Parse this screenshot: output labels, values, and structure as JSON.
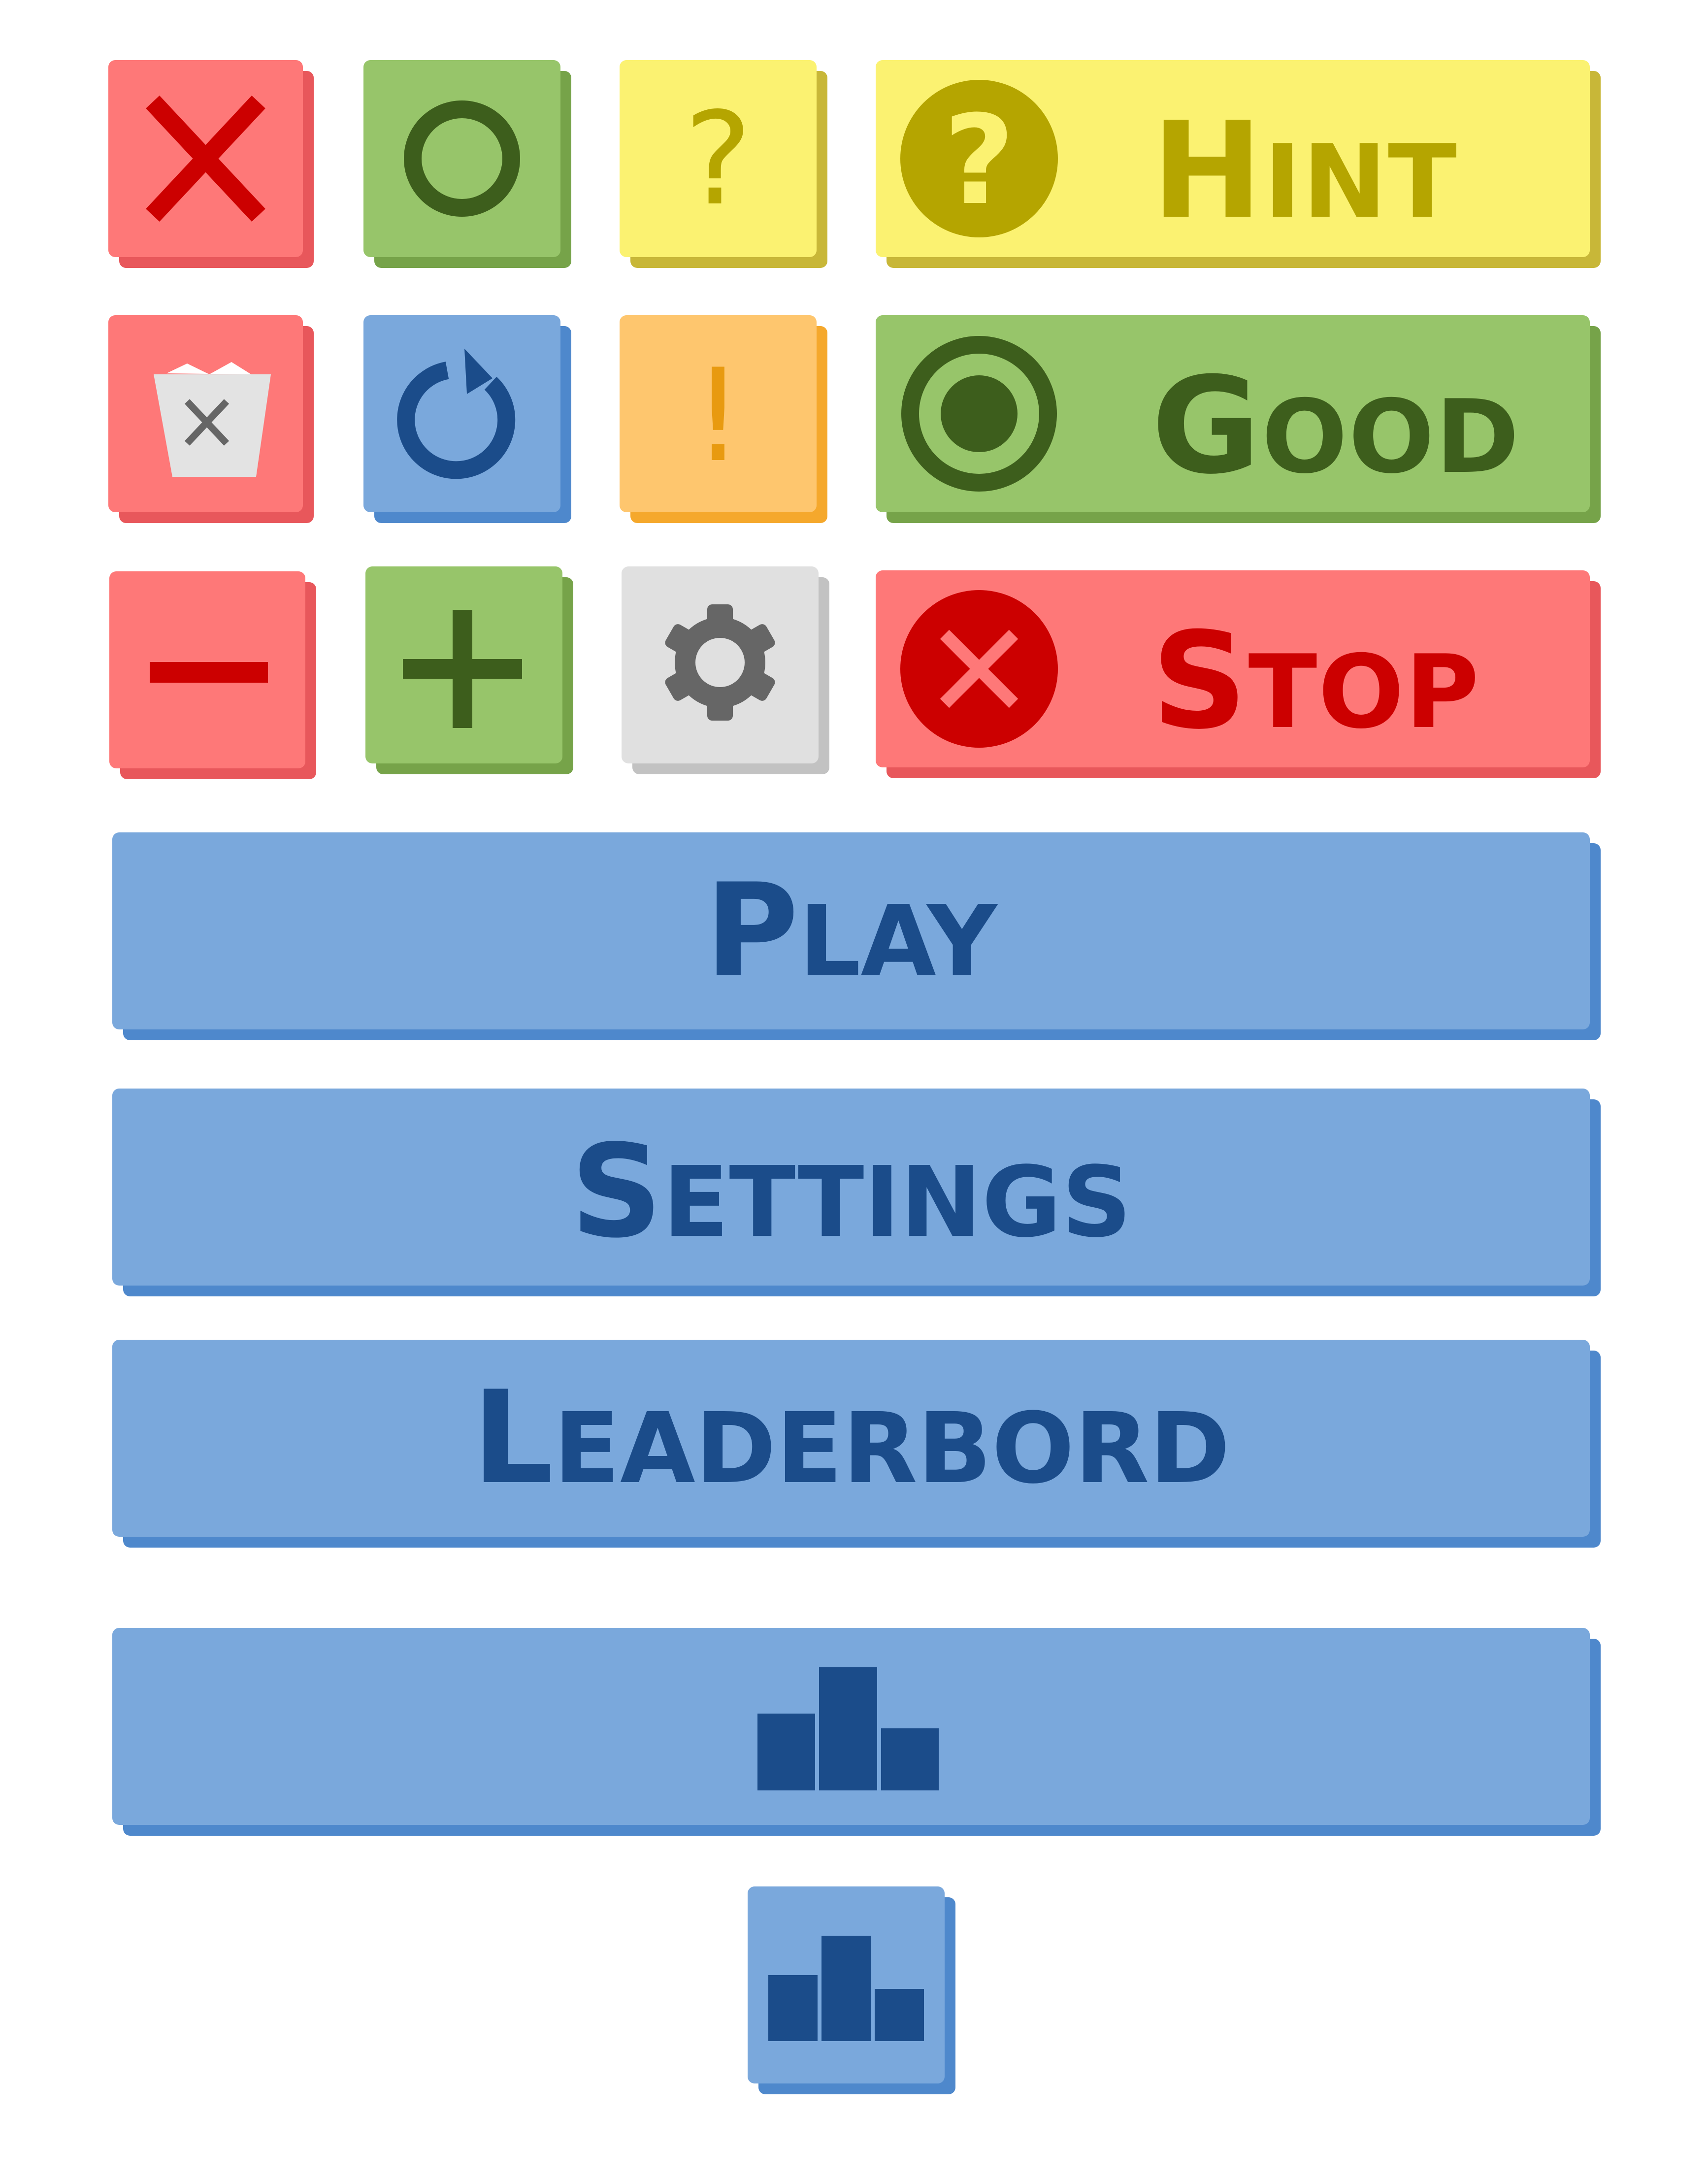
{
  "colors": {
    "red_face": "#fe7878",
    "red_shadow": "#e8575b",
    "red_icon": "#cc0000",
    "green_face": "#97c56a",
    "green_shadow": "#76a349",
    "green_icon": "#3d5e1c",
    "yellow_face": "#fbf271",
    "yellow_shadow": "#c8b738",
    "yellow_icon": "#b5a500",
    "blue_face": "#7aa8dc",
    "blue_shadow": "#4e88cc",
    "blue_icon": "#1b4c8a",
    "orange_face": "#fec66e",
    "orange_shadow": "#f5a82c",
    "orange_icon": "#e89a10",
    "gray_face": "#e0e0e0",
    "gray_shadow": "#c2c2c2",
    "gray_icon": "#666666"
  },
  "icon_buttons": [
    {
      "name": "close-button",
      "icon": "close-icon"
    },
    {
      "name": "confirm-button",
      "icon": "circle-icon"
    },
    {
      "name": "question-button",
      "icon": "question-icon"
    },
    {
      "name": "trash-button",
      "icon": "trash-icon"
    },
    {
      "name": "restart-button",
      "icon": "restart-icon"
    },
    {
      "name": "alert-button",
      "icon": "exclamation-icon"
    },
    {
      "name": "minus-button",
      "icon": "minus-icon"
    },
    {
      "name": "plus-button",
      "icon": "plus-icon"
    },
    {
      "name": "settings-button",
      "icon": "gear-icon"
    },
    {
      "name": "leaderboard-small-button",
      "icon": "podium-icon"
    }
  ],
  "wide_buttons": {
    "hint": {
      "first": "H",
      "rest": "int",
      "icon": "question-circle-icon"
    },
    "good": {
      "first": "G",
      "rest": "ood",
      "icon": "target-circle-icon"
    },
    "stop": {
      "first": "S",
      "rest": "top",
      "icon": "x-circle-icon"
    }
  },
  "menu": {
    "play": {
      "first": "P",
      "rest": "lay"
    },
    "settings": {
      "first": "S",
      "rest": "ettings"
    },
    "leaderboard": {
      "first": "L",
      "rest": "eaderbord"
    },
    "leaderboard_icon": "podium-icon"
  },
  "glyphs": {
    "question": "?",
    "exclamation": "!"
  }
}
